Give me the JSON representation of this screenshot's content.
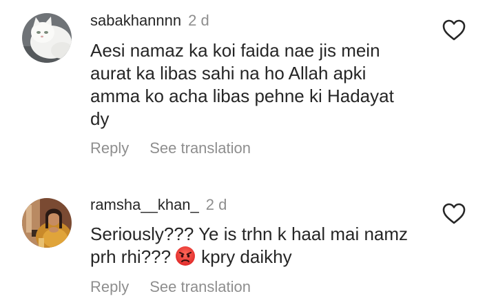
{
  "comments": [
    {
      "username": "sabakhannnn",
      "age": "2 d",
      "lines": [
        "Aesi namaz ka koi faida nae jis mein",
        "aurat ka libas sahi na ho Allah apki",
        "amma ko acha libas pehne ki Hadayat",
        "dy"
      ],
      "reply_label": "Reply",
      "translate_label": "See translation",
      "avatar_icon": "white-cat-avatar",
      "like_icon": "heart-outline-icon"
    },
    {
      "username": "ramsha__khan_",
      "age": "2 d",
      "line1": "Seriously??? Ye is trhn k haal mai namz",
      "line2_before": "prh rhi???",
      "line2_emoji": "angry-face-emoji",
      "line2_after": "kpry daikhy",
      "reply_label": "Reply",
      "translate_label": "See translation",
      "avatar_icon": "woman-portrait-avatar",
      "like_icon": "heart-outline-icon"
    }
  ],
  "colors": {
    "text_primary": "#262626",
    "text_secondary": "#8e8e8e",
    "background": "#ffffff"
  }
}
